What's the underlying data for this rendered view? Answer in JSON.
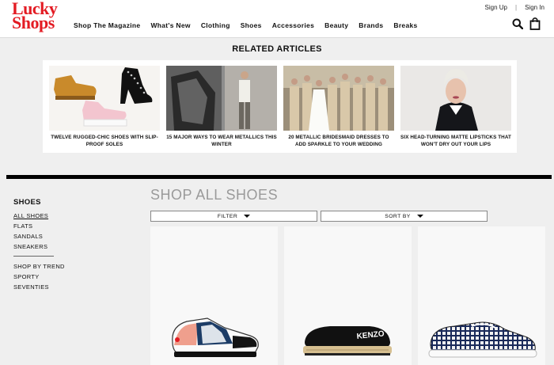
{
  "header": {
    "logo_line1": "Lucky",
    "logo_line2": "Shops",
    "nav": [
      "Shop The Magazine",
      "What's New",
      "Clothing",
      "Shoes",
      "Accessories",
      "Beauty",
      "Brands",
      "Breaks"
    ],
    "sign_up": "Sign Up",
    "separator": "|",
    "sign_in": "Sign In",
    "icons": [
      "search-icon",
      "shopping-bag-icon"
    ]
  },
  "related": {
    "title": "RELATED ARTICLES",
    "articles": [
      {
        "caption": "TWELVE RUGGED-CHIC SHOES WITH SLIP-PROOF SOLES"
      },
      {
        "caption": "15 MAJOR WAYS TO WEAR METALLICS THIS WINTER"
      },
      {
        "caption": "20 METALLIC BRIDESMAID DRESSES TO ADD SPARKLE TO YOUR WEDDING"
      },
      {
        "caption": "SIX HEAD-TURNING MATTE LIPSTICKS THAT WON'T DRY OUT YOUR LIPS"
      }
    ]
  },
  "sidebar": {
    "heading": "SHOES",
    "items": [
      "ALL SHOES",
      "FLATS",
      "SANDALS",
      "SNEAKERS"
    ],
    "items2": [
      "SHOP BY TREND",
      "SPORTY",
      "SEVENTIES"
    ]
  },
  "shop": {
    "title": "SHOP ALL SHOES",
    "filter_label": "FILTER",
    "sort_label": "SORT BY"
  },
  "colors": {
    "brand_red": "#e31b23",
    "page_bg": "#efefef",
    "divider": "#000000"
  }
}
